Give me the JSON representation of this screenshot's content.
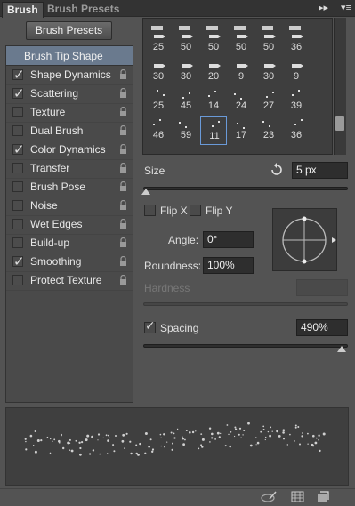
{
  "tabs": {
    "brush": "Brush",
    "brush_presets": "Brush Presets"
  },
  "panel_menu": "▾≡",
  "panel_collapse": "▸▸",
  "presets_button": "Brush Presets",
  "sidebar": {
    "tip_shape": "Brush Tip Shape",
    "items": [
      {
        "label": "Shape Dynamics",
        "checked": true
      },
      {
        "label": "Scattering",
        "checked": true
      },
      {
        "label": "Texture",
        "checked": false
      },
      {
        "label": "Dual Brush",
        "checked": false
      },
      {
        "label": "Color Dynamics",
        "checked": true
      },
      {
        "label": "Transfer",
        "checked": false
      },
      {
        "label": "Brush Pose",
        "checked": false
      },
      {
        "label": "Noise",
        "checked": false
      },
      {
        "label": "Wet Edges",
        "checked": false
      },
      {
        "label": "Build-up",
        "checked": false
      },
      {
        "label": "Smoothing",
        "checked": true
      },
      {
        "label": "Protect Texture",
        "checked": false
      }
    ]
  },
  "brush_grid": {
    "rows": [
      [
        "25",
        "50",
        "50",
        "50",
        "50",
        "36"
      ],
      [
        "30",
        "30",
        "20",
        "9",
        "30",
        "9"
      ],
      [
        "25",
        "45",
        "14",
        "24",
        "27",
        "39"
      ],
      [
        "46",
        "59",
        "11",
        "17",
        "23",
        "36"
      ]
    ],
    "selected": [
      3,
      2
    ]
  },
  "size": {
    "label": "Size",
    "value": "5 px",
    "slider_fraction": 0.01
  },
  "flip_x": {
    "label": "Flip X",
    "checked": false
  },
  "flip_y": {
    "label": "Flip Y",
    "checked": false
  },
  "angle": {
    "label": "Angle:",
    "value": "0°"
  },
  "roundness": {
    "label": "Roundness:",
    "value": "100%"
  },
  "hardness": {
    "label": "Hardness"
  },
  "spacing": {
    "label": "Spacing",
    "checked": true,
    "value": "490%",
    "slider_fraction": 0.97
  }
}
